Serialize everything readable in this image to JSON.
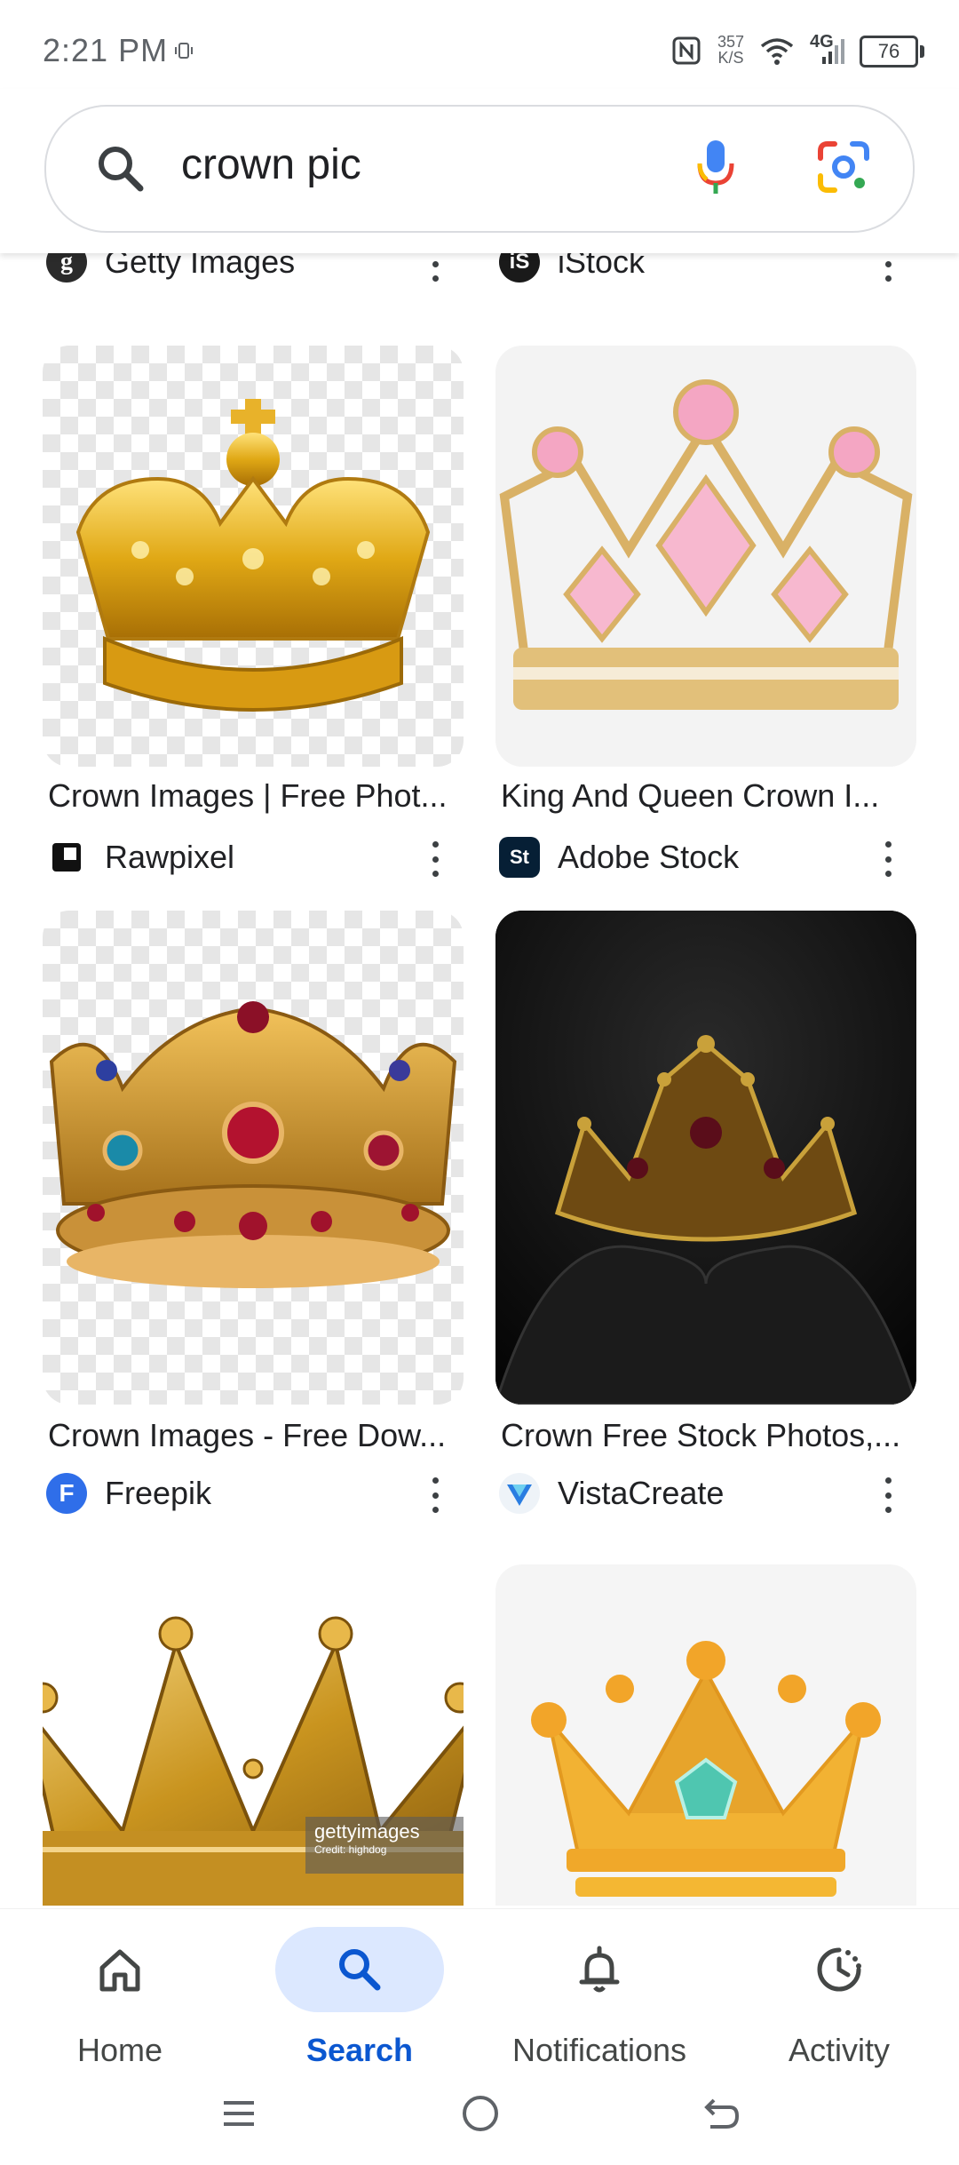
{
  "status_bar": {
    "time": "2:21 PM",
    "net_speed_value": "357",
    "net_speed_unit": "K/S",
    "network": "4G",
    "battery": "76"
  },
  "search": {
    "query": "crown pic"
  },
  "top_sources": [
    {
      "name": "Getty Images",
      "logo": "g"
    },
    {
      "name": "iStock",
      "logo": "iS"
    }
  ],
  "results": [
    {
      "title": "Crown Images | Free Phot...",
      "source": "Rawpixel",
      "logo": "rawpixel-icon",
      "image": "gold-crown-transparent"
    },
    {
      "title": "King And Queen Crown I...",
      "source": "Adobe Stock",
      "logo": "St",
      "image": "pink-gem-crown"
    },
    {
      "title": "Crown Images - Free Dow...",
      "source": "Freepik",
      "logo": "F",
      "image": "jeweled-gold-crown"
    },
    {
      "title": "Crown Free Stock Photos,...",
      "source": "VistaCreate",
      "logo": "vistacreate-icon",
      "image": "dark-crown-on-black"
    },
    {
      "title": "",
      "source": "",
      "image": "gold-crown-getty",
      "watermark": "gettyimages",
      "watermark_credit": "Credit: highdog"
    },
    {
      "title": "",
      "source": "",
      "image": "flat-crown-illustration"
    }
  ],
  "bottom_nav": [
    {
      "label": "Home",
      "icon": "home-icon"
    },
    {
      "label": "Search",
      "icon": "search-icon",
      "active": true
    },
    {
      "label": "Notifications",
      "icon": "bell-icon"
    },
    {
      "label": "Activity",
      "icon": "activity-icon"
    }
  ],
  "colors": {
    "accent": "#0b57d0",
    "active_pill": "#dce8ff"
  }
}
